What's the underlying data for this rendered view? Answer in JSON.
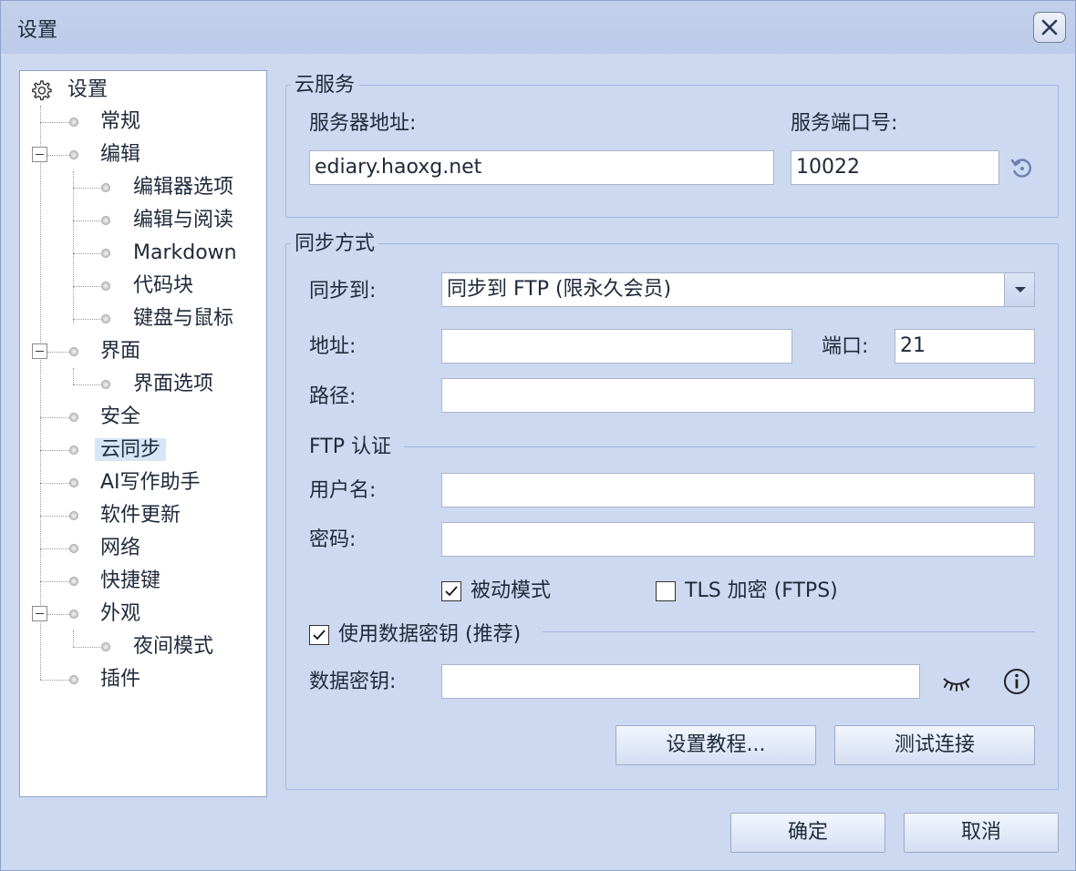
{
  "window": {
    "title": "设置"
  },
  "tree": {
    "root": "设置",
    "items": [
      {
        "label": "常规"
      },
      {
        "label": "编辑"
      },
      {
        "label": "编辑器选项"
      },
      {
        "label": "编辑与阅读"
      },
      {
        "label": "Markdown"
      },
      {
        "label": "代码块"
      },
      {
        "label": "键盘与鼠标"
      },
      {
        "label": "界面"
      },
      {
        "label": "界面选项"
      },
      {
        "label": "安全"
      },
      {
        "label": "云同步"
      },
      {
        "label": "AI写作助手"
      },
      {
        "label": "软件更新"
      },
      {
        "label": "网络"
      },
      {
        "label": "快捷键"
      },
      {
        "label": "外观"
      },
      {
        "label": "夜间模式"
      },
      {
        "label": "插件"
      }
    ]
  },
  "cloud": {
    "title": "云服务",
    "server_label": "服务器地址:",
    "server_value": "ediary.haoxg.net",
    "port_label": "服务端口号:",
    "port_value": "10022"
  },
  "sync": {
    "title": "同步方式",
    "to_label": "同步到:",
    "to_value": "同步到 FTP (限永久会员)",
    "addr_label": "地址:",
    "addr_value": "",
    "port_label": "端口:",
    "port_value": "21",
    "path_label": "路径:",
    "path_value": "",
    "ftp_auth": "FTP 认证",
    "user_label": "用户名:",
    "user_value": "",
    "pass_label": "密码:",
    "pass_value": "",
    "passive_label": "被动模式",
    "tls_label": "TLS 加密 (FTPS)",
    "use_key_label": "使用数据密钥 (推荐)",
    "key_label": "数据密钥:",
    "key_value": "",
    "tutorial_btn": "设置教程...",
    "test_btn": "测试连接"
  },
  "footer": {
    "ok": "确定",
    "cancel": "取消"
  }
}
